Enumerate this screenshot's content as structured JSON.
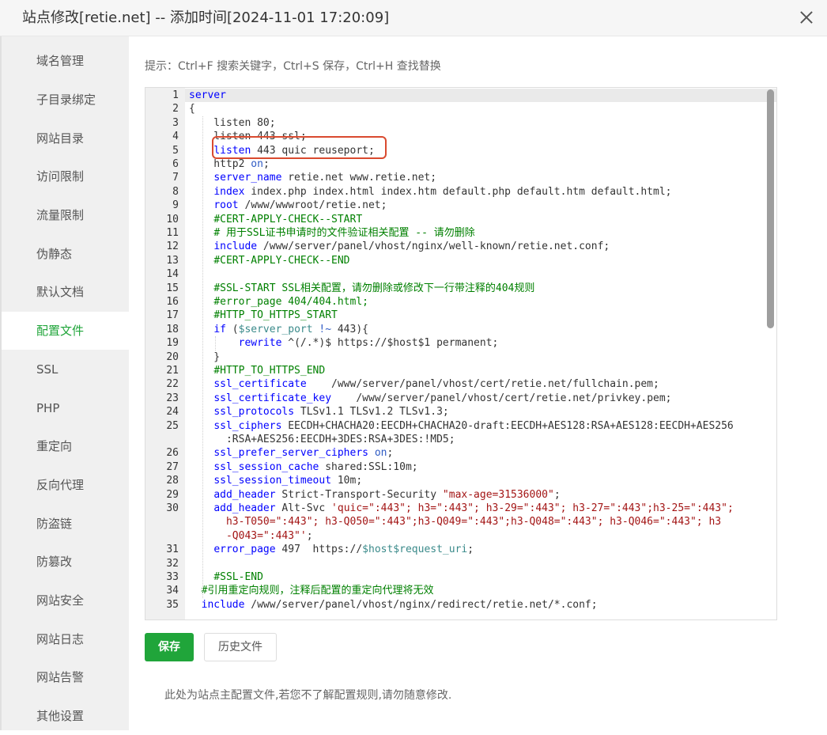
{
  "window": {
    "title": "站点修改[retie.net] -- 添加时间[2024-11-01 17:20:09]"
  },
  "sidebar": {
    "items": [
      {
        "label": "域名管理",
        "active": false
      },
      {
        "label": "子目录绑定",
        "active": false
      },
      {
        "label": "网站目录",
        "active": false
      },
      {
        "label": "访问限制",
        "active": false
      },
      {
        "label": "流量限制",
        "active": false
      },
      {
        "label": "伪静态",
        "active": false
      },
      {
        "label": "默认文档",
        "active": false
      },
      {
        "label": "配置文件",
        "active": true
      },
      {
        "label": "SSL",
        "active": false
      },
      {
        "label": "PHP",
        "active": false
      },
      {
        "label": "重定向",
        "active": false
      },
      {
        "label": "反向代理",
        "active": false
      },
      {
        "label": "防盗链",
        "active": false
      },
      {
        "label": "防篡改",
        "active": false
      },
      {
        "label": "网站安全",
        "active": false
      },
      {
        "label": "网站日志",
        "active": false
      },
      {
        "label": "网站告警",
        "active": false
      },
      {
        "label": "其他设置",
        "active": false
      }
    ]
  },
  "hint": "提示：Ctrl+F 搜索关键字，Ctrl+S 保存，Ctrl+H 查找替换",
  "editor": {
    "lines": [
      {
        "n": "1",
        "segs": [
          [
            "server",
            "k"
          ]
        ]
      },
      {
        "n": "2",
        "segs": [
          [
            "{",
            ""
          ]
        ]
      },
      {
        "n": "3",
        "segs": [
          [
            "    listen 80;",
            ""
          ]
        ]
      },
      {
        "n": "4",
        "segs": [
          [
            "    listen 443 ssl;",
            ""
          ]
        ]
      },
      {
        "n": "5",
        "segs": [
          [
            "    ",
            ""
          ],
          [
            "listen",
            "k"
          ],
          [
            " 443 quic reuseport;",
            ""
          ]
        ]
      },
      {
        "n": "6",
        "segs": [
          [
            "    http2 ",
            ""
          ],
          [
            "on",
            "b"
          ],
          [
            ";",
            ""
          ]
        ]
      },
      {
        "n": "7",
        "segs": [
          [
            "    ",
            ""
          ],
          [
            "server_name",
            "k"
          ],
          [
            " retie.net www.retie.net;",
            ""
          ]
        ]
      },
      {
        "n": "8",
        "segs": [
          [
            "    ",
            ""
          ],
          [
            "index",
            "k"
          ],
          [
            " index.php index.html index.htm default.php default.htm default.html;",
            ""
          ]
        ]
      },
      {
        "n": "9",
        "segs": [
          [
            "    ",
            ""
          ],
          [
            "root",
            "k"
          ],
          [
            " /www/wwwroot/retie.net;",
            ""
          ]
        ]
      },
      {
        "n": "10",
        "segs": [
          [
            "    ",
            ""
          ],
          [
            "#CERT-APPLY-CHECK--START",
            "c"
          ]
        ]
      },
      {
        "n": "11",
        "segs": [
          [
            "    ",
            ""
          ],
          [
            "# 用于SSL证书申请时的文件验证相关配置 -- 请勿删除",
            "c"
          ]
        ]
      },
      {
        "n": "12",
        "segs": [
          [
            "    ",
            ""
          ],
          [
            "include",
            "k"
          ],
          [
            " /www/server/panel/vhost/nginx/well-known/retie.net.conf;",
            ""
          ]
        ]
      },
      {
        "n": "13",
        "segs": [
          [
            "    ",
            ""
          ],
          [
            "#CERT-APPLY-CHECK--END",
            "c"
          ]
        ]
      },
      {
        "n": "14",
        "segs": []
      },
      {
        "n": "15",
        "segs": [
          [
            "    ",
            ""
          ],
          [
            "#SSL-START SSL相关配置，请勿删除或修改下一行带注释的404规则",
            "c"
          ]
        ]
      },
      {
        "n": "16",
        "segs": [
          [
            "    ",
            ""
          ],
          [
            "#error_page 404/404.html;",
            "c"
          ]
        ]
      },
      {
        "n": "17",
        "segs": [
          [
            "    ",
            ""
          ],
          [
            "#HTTP_TO_HTTPS_START",
            "c"
          ]
        ]
      },
      {
        "n": "18",
        "segs": [
          [
            "    ",
            ""
          ],
          [
            "if",
            "k"
          ],
          [
            " (",
            ""
          ],
          [
            "$server_port",
            "v"
          ],
          [
            " ",
            ""
          ],
          [
            "!~",
            "b"
          ],
          [
            " 443){",
            ""
          ]
        ]
      },
      {
        "n": "19",
        "segs": [
          [
            "        ",
            ""
          ],
          [
            "rewrite",
            "k"
          ],
          [
            " ^(/.*)$ https://$host$1 permanent;",
            ""
          ]
        ]
      },
      {
        "n": "20",
        "segs": [
          [
            "    }",
            ""
          ]
        ]
      },
      {
        "n": "21",
        "segs": [
          [
            "    ",
            ""
          ],
          [
            "#HTTP_TO_HTTPS_END",
            "c"
          ]
        ]
      },
      {
        "n": "22",
        "segs": [
          [
            "    ",
            ""
          ],
          [
            "ssl_certificate",
            "k"
          ],
          [
            "    /www/server/panel/vhost/cert/retie.net/fullchain.pem;",
            ""
          ]
        ]
      },
      {
        "n": "23",
        "segs": [
          [
            "    ",
            ""
          ],
          [
            "ssl_certificate_key",
            "k"
          ],
          [
            "    /www/server/panel/vhost/cert/retie.net/privkey.pem;",
            ""
          ]
        ]
      },
      {
        "n": "24",
        "segs": [
          [
            "    ",
            ""
          ],
          [
            "ssl_protocols",
            "k"
          ],
          [
            " TLSv1.1 TLSv1.2 TLSv1.3;",
            ""
          ]
        ]
      },
      {
        "n": "25",
        "segs": [
          [
            "    ",
            ""
          ],
          [
            "ssl_ciphers",
            "k"
          ],
          [
            " EECDH+CHACHA20:EECDH+CHACHA20-draft:EECDH+AES128:RSA+AES128:EECDH+AES256",
            ""
          ]
        ]
      },
      {
        "n": "",
        "segs": [
          [
            "      :RSA+AES256:EECDH+3DES:RSA+3DES:!MD5;",
            ""
          ]
        ]
      },
      {
        "n": "26",
        "segs": [
          [
            "    ",
            ""
          ],
          [
            "ssl_prefer_server_ciphers",
            "k"
          ],
          [
            " ",
            ""
          ],
          [
            "on",
            "b"
          ],
          [
            ";",
            ""
          ]
        ]
      },
      {
        "n": "27",
        "segs": [
          [
            "    ",
            ""
          ],
          [
            "ssl_session_cache",
            "k"
          ],
          [
            " shared:SSL:10m;",
            ""
          ]
        ]
      },
      {
        "n": "28",
        "segs": [
          [
            "    ",
            ""
          ],
          [
            "ssl_session_timeout",
            "k"
          ],
          [
            " 10m;",
            ""
          ]
        ]
      },
      {
        "n": "29",
        "segs": [
          [
            "    ",
            ""
          ],
          [
            "add_header",
            "k"
          ],
          [
            " Strict-Transport-Security ",
            ""
          ],
          [
            "\"max-age=31536000\"",
            "s"
          ],
          [
            ";",
            ""
          ]
        ]
      },
      {
        "n": "30",
        "segs": [
          [
            "    ",
            ""
          ],
          [
            "add_header",
            "k"
          ],
          [
            " Alt-Svc ",
            ""
          ],
          [
            "'quic=\":443\"; h3=\":443\"; h3-29=\":443\"; h3-27=\":443\";h3-25=\":443\";",
            "s"
          ]
        ]
      },
      {
        "n": "",
        "segs": [
          [
            "      ",
            ""
          ],
          [
            "h3-T050=\":443\"; h3-Q050=\":443\";h3-Q049=\":443\";h3-Q048=\":443\"; h3-Q046=\":443\"; h3",
            "s"
          ]
        ]
      },
      {
        "n": "",
        "segs": [
          [
            "      ",
            ""
          ],
          [
            "-Q043=\":443\"'",
            "s"
          ],
          [
            ";",
            ""
          ]
        ]
      },
      {
        "n": "31",
        "segs": [
          [
            "    ",
            ""
          ],
          [
            "error_page",
            "k"
          ],
          [
            " 497  https://",
            ""
          ],
          [
            "$host$request_uri",
            "v"
          ],
          [
            ";",
            ""
          ]
        ]
      },
      {
        "n": "32",
        "segs": []
      },
      {
        "n": "33",
        "segs": [
          [
            "    ",
            ""
          ],
          [
            "#SSL-END",
            "c"
          ]
        ]
      },
      {
        "n": "34",
        "segs": [
          [
            "  ",
            ""
          ],
          [
            "#引用重定向规则，注释后配置的重定向代理将无效",
            "c"
          ]
        ]
      },
      {
        "n": "35",
        "segs": [
          [
            "  ",
            ""
          ],
          [
            "include",
            "k"
          ],
          [
            " /www/server/panel/vhost/nginx/redirect/retie.net/*.conf;",
            ""
          ]
        ]
      }
    ]
  },
  "actions": {
    "save_label": "保存",
    "history_label": "历史文件"
  },
  "footer_note": "此处为站点主配置文件,若您不了解配置规则,请勿随意修改.",
  "colors": {
    "accent": "#20a53a",
    "highlight_border": "#d94a2f",
    "keyword": "#0000ff",
    "comment": "#008000",
    "string": "#a31515"
  }
}
